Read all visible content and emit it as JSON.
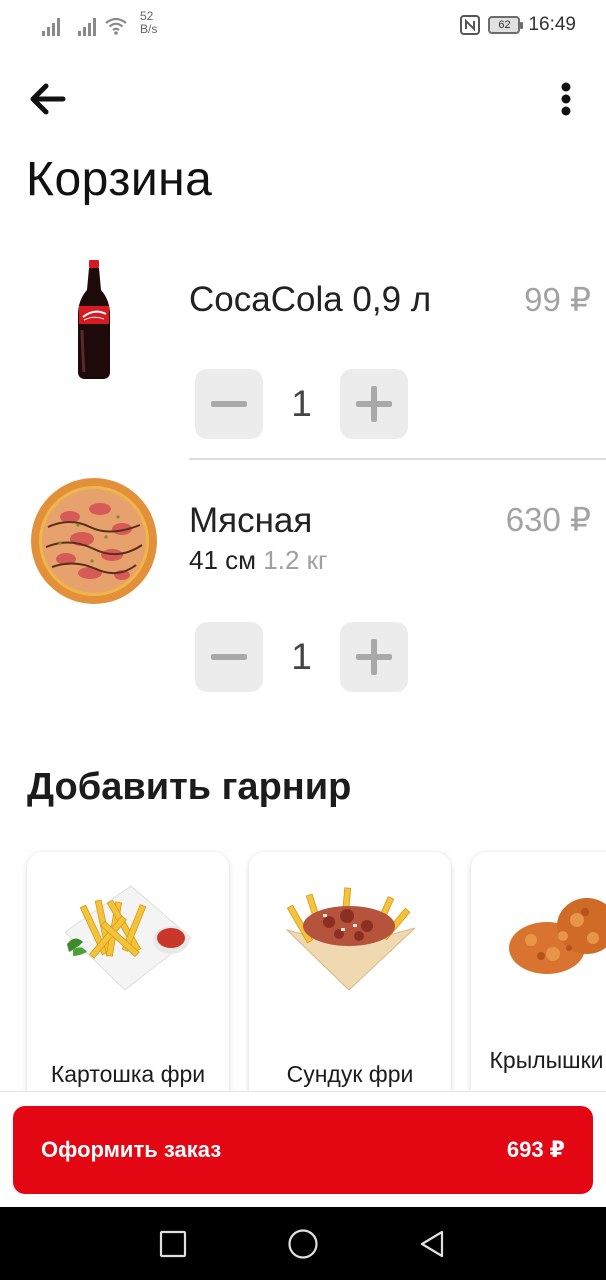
{
  "status_bar": {
    "net_speed_value": "52",
    "net_speed_unit": "B/s",
    "battery_level": "62",
    "time": "16:49"
  },
  "page": {
    "title": "Корзина"
  },
  "cart": {
    "items": [
      {
        "name": "CocaCola 0,9 л",
        "price": "99 ₽",
        "size": "",
        "weight": "",
        "quantity": "1",
        "image_icon": "cola-bottle-image"
      },
      {
        "name": "Мясная",
        "price": "630 ₽",
        "size": "41 см",
        "weight": "1.2 кг",
        "quantity": "1",
        "image_icon": "pizza-image"
      }
    ]
  },
  "garnish": {
    "title": "Добавить гарнир",
    "items": [
      {
        "label": "Картошка фри",
        "image_icon": "french-fries-image"
      },
      {
        "label": "Сундук фри",
        "image_icon": "fries-box-image"
      },
      {
        "label": "Крылышки фри",
        "image_icon": "chicken-wings-image"
      }
    ]
  },
  "order": {
    "button_label": "Оформить заказ",
    "total": "693 ₽"
  },
  "colors": {
    "accent": "#e30613",
    "price_gray": "#a3a3a3",
    "qty_button_bg": "#ececec"
  }
}
